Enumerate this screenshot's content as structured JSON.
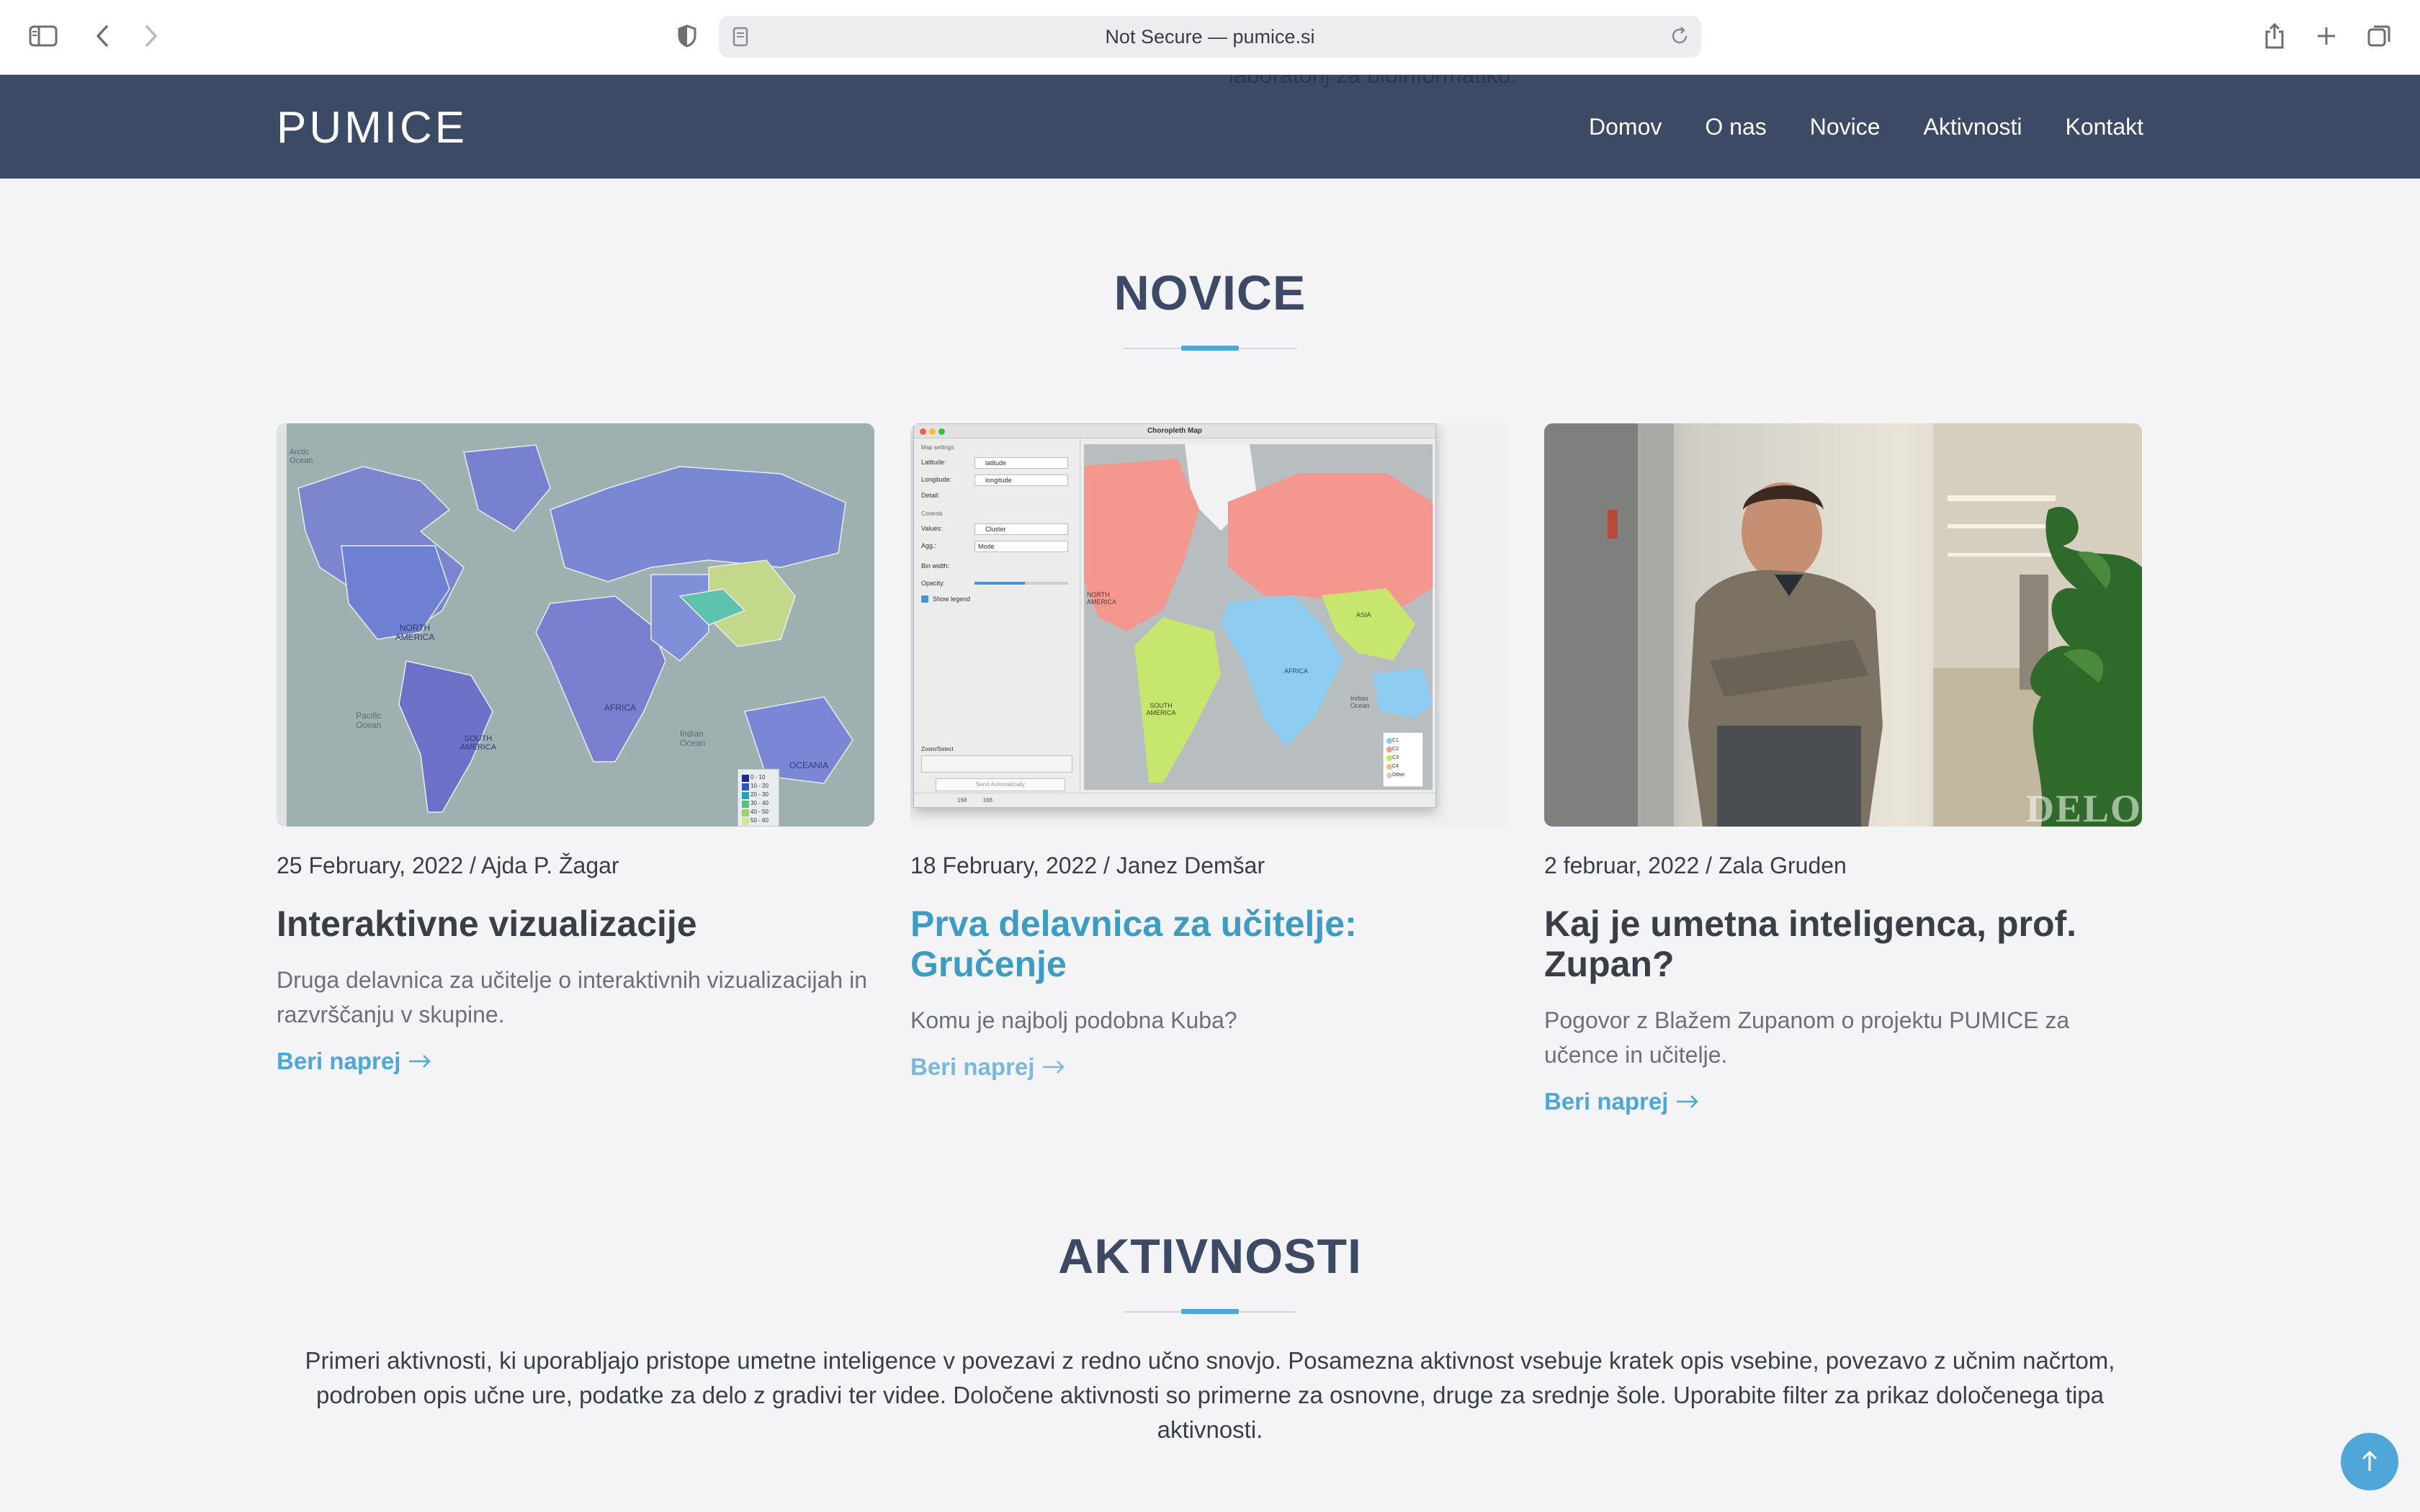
{
  "browser": {
    "url_text": "Not Secure — pumice.si"
  },
  "site": {
    "logo": "PUMICE",
    "ghost_text": "laboratorij za bioinformatiko.",
    "nav": [
      "Domov",
      "O nas",
      "Novice",
      "Aktivnosti",
      "Kontakt"
    ]
  },
  "novice": {
    "heading": "NOVICE",
    "cards": [
      {
        "meta": "25 February, 2022 / Ajda P. Žagar",
        "title": "Interaktivne vizualizacije",
        "desc": "Druga delavnica za učitelje o interaktivnih vizualizacijah in razvrščanju v skupine.",
        "more": "Beri naprej",
        "image_icon": "world-choropleth-map",
        "map_labels": {
          "arctic": "Arctic Ocean",
          "north_america": "NORTH AMERICA",
          "south_america": "SOUTH AMERICA",
          "pacific": "Pacific Ocean",
          "africa": "AFRICA",
          "indian": "Indian Ocean",
          "oceania": "OCEANIA"
        },
        "legend": [
          "0 - 10",
          "10 - 20",
          "20 - 30",
          "30 - 40",
          "40 - 50",
          "50 - 60"
        ]
      },
      {
        "meta": "18 February, 2022 / Janez Demšar",
        "title": "Prva delavnica za učitelje: Gručenje",
        "desc": "Komu je najbolj podobna Kuba?",
        "more": "Beri naprej",
        "image_icon": "orange-choropleth-widget",
        "widget": {
          "window_title": "Choropleth Map",
          "section_map": "Map settings",
          "latitude_label": "Latitude:",
          "latitude_value": "latitude",
          "longitude_label": "Longitude:",
          "longitude_value": "longitude",
          "detail_label": "Detail:",
          "section_controls": "Controls",
          "values_label": "Values:",
          "values_value": "Cluster",
          "agg_label": "Agg.:",
          "agg_value": "Mode",
          "bin_label": "Bin width:",
          "opacity_label": "Opacity:",
          "legend_label": "Show legend",
          "zoom_label": "Zoom/Select",
          "send_label": "Send Automatically",
          "status_left": "168",
          "status_right": "168",
          "map_labels": {
            "north_america": "NORTH AMERICA",
            "south_america": "SOUTH AMERICA",
            "africa": "AFRICA",
            "asia": "ASIA",
            "indian": "Indian Ocean"
          },
          "legend": [
            "C1",
            "C2",
            "C3",
            "C4",
            "Other"
          ]
        }
      },
      {
        "meta": "2 februar, 2022 / Zala Gruden",
        "title": "Kaj je umetna inteligenca, prof. Zupan?",
        "desc": "Pogovor z Blažem Zupanom o projektu PUMICE za učence in učitelje.",
        "more": "Beri naprej",
        "image_icon": "portrait-photo",
        "watermark": "DELO"
      }
    ]
  },
  "aktivnosti": {
    "heading": "AKTIVNOSTI",
    "intro": "Primeri aktivnosti, ki uporabljajo pristope umetne inteligence v povezavi z redno učno snovjo. Posamezna aktivnost vsebuje kratek opis vsebine, povezavo z učnim načrtom, podroben opis učne ure, podatke za delo z gradivi ter videe. Določene aktivnosti so primerne za osnovne, druge za srednje šole. Uporabite filter za prikaz določenega tipa aktivnosti."
  },
  "colors": {
    "header_bg": "#3d4a66",
    "accent": "#4fa6d8",
    "page_bg": "#f4f4f6"
  }
}
